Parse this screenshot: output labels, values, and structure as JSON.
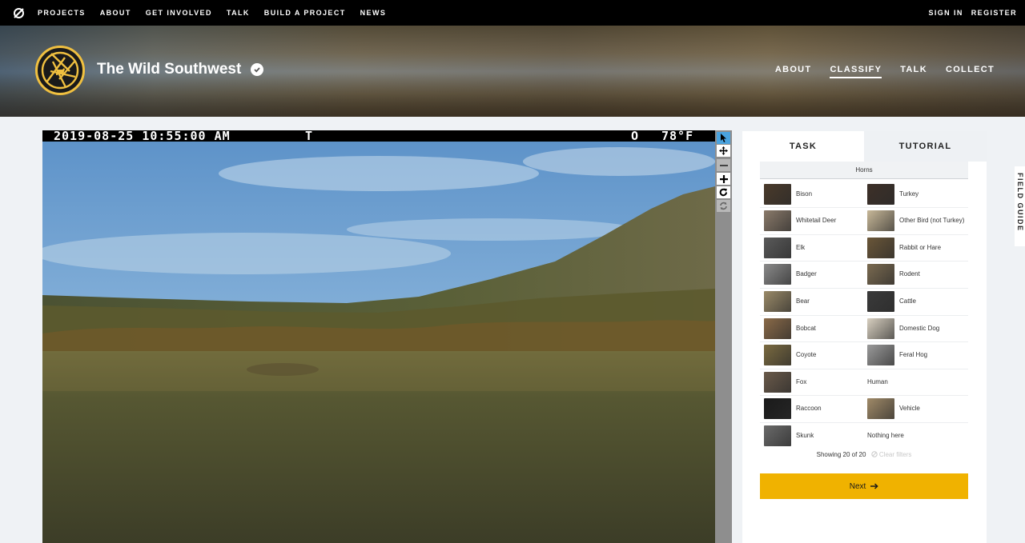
{
  "topnav": {
    "items": [
      "PROJECTS",
      "ABOUT",
      "GET INVOLVED",
      "TALK",
      "BUILD A PROJECT",
      "NEWS"
    ],
    "sign_in": "SIGN IN",
    "register": "REGISTER"
  },
  "project": {
    "title": "The Wild Southwest",
    "nav": [
      "ABOUT",
      "CLASSIFY",
      "TALK",
      "COLLECT"
    ],
    "active_nav": "CLASSIFY"
  },
  "camera": {
    "datetime": "2019-08-25 10:55:00 AM",
    "mark": "T",
    "moon": "O",
    "temperature": "78°F"
  },
  "task": {
    "tabs": [
      "TASK",
      "TUTORIAL"
    ],
    "filter_label": "Horns",
    "choices": [
      {
        "label": "Bison",
        "thumb_color": "#4a3a2a"
      },
      {
        "label": "Turkey",
        "thumb_color": "#3d3028"
      },
      {
        "label": "Whitetail Deer",
        "thumb_color": "#8a7a6a"
      },
      {
        "label": "Other Bird (not Turkey)",
        "thumb_color": "#c8b898"
      },
      {
        "label": "Elk",
        "thumb_color": "#5a5a5a"
      },
      {
        "label": "Rabbit or Hare",
        "thumb_color": "#6a5638"
      },
      {
        "label": "Badger",
        "thumb_color": "#8a8a8a"
      },
      {
        "label": "Rodent",
        "thumb_color": "#7a6a50"
      },
      {
        "label": "Bear",
        "thumb_color": "#9a8a68"
      },
      {
        "label": "Cattle",
        "thumb_color": "#3a3a3a"
      },
      {
        "label": "Bobcat",
        "thumb_color": "#8a6a48"
      },
      {
        "label": "Domestic Dog",
        "thumb_color": "#d8d0c0"
      },
      {
        "label": "Coyote",
        "thumb_color": "#7a6a40"
      },
      {
        "label": "Feral Hog",
        "thumb_color": "#9a9a9a"
      },
      {
        "label": "Fox",
        "thumb_color": "#6a5a4a"
      },
      {
        "label": "Human",
        "thumb_color": ""
      },
      {
        "label": "Raccoon",
        "thumb_color": "#1a1a1a"
      },
      {
        "label": "Vehicle",
        "thumb_color": "#a08a68"
      },
      {
        "label": "Skunk",
        "thumb_color": "#6a6a6a"
      },
      {
        "label": "Nothing here",
        "thumb_color": ""
      }
    ],
    "showing": "Showing 20 of 20",
    "clear_filters": "Clear filters",
    "next_label": "Next"
  },
  "field_guide": "FIELD GUIDE",
  "colors": {
    "accent_yellow": "#f0b200",
    "active_tool": "#4aa3df"
  },
  "icons": {
    "logo": "zooniverse-logo-icon",
    "verified": "check-circle-icon",
    "tools": [
      "pointer-icon",
      "move-icon",
      "zoom-out-icon",
      "zoom-in-icon",
      "rotate-icon",
      "reset-icon"
    ],
    "next": "arrow-right-icon",
    "clear": "ban-icon"
  }
}
